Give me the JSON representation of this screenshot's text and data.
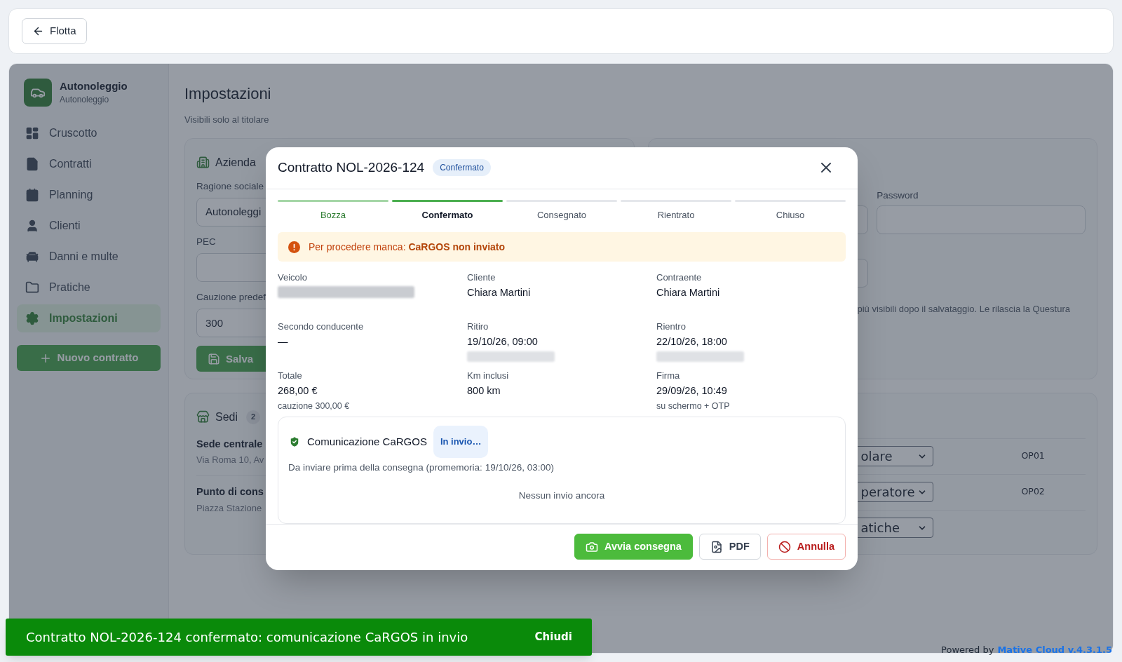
{
  "top_bar": {
    "back_button": "Flotta"
  },
  "sidebar": {
    "app_name": "Autonoleggio",
    "app_subtitle": "Autonoleggio",
    "items": [
      {
        "label": "Cruscotto",
        "selected": false
      },
      {
        "label": "Contratti",
        "selected": false
      },
      {
        "label": "Planning",
        "selected": false
      },
      {
        "label": "Clienti",
        "selected": false
      },
      {
        "label": "Danni e multe",
        "selected": false
      },
      {
        "label": "Pratiche",
        "selected": false
      },
      {
        "label": "Impostazioni",
        "selected": true
      }
    ],
    "new_button": "Nuovo contratto"
  },
  "page": {
    "title": "Impostazioni",
    "subtitle": "Visibili solo al titolare",
    "company_card": {
      "title": "Azienda",
      "fields": [
        {
          "label": "Ragione sociale",
          "value": "Autonoleggi"
        },
        {
          "label": "PEC"
        },
        {
          "label": "Cauzione predef",
          "value": "300"
        }
      ],
      "save_button": "Salva"
    },
    "credentials_card": {
      "password_label": "Password",
      "note": "più visibili dopo il salvataggio. Le rilascia la Questura"
    },
    "locations_card": {
      "title": "Sedi",
      "count": "2",
      "items": [
        {
          "name": "Sede centrale",
          "address": "Via Roma 10, Av"
        },
        {
          "name": "Punto di cons",
          "address": "Piazza Stazione"
        }
      ]
    },
    "users_card": {
      "rows": [
        {
          "role": "olare",
          "code": "OP01"
        },
        {
          "role": "peratore",
          "code": "OP02"
        },
        {
          "role": "atiche"
        }
      ]
    }
  },
  "modal": {
    "title": "Contratto NOL-2026-124",
    "status_badge": "Confermato",
    "steps": [
      {
        "label": "Bozza",
        "done": true,
        "selected": false
      },
      {
        "label": "Confermato",
        "done": false,
        "selected": true
      },
      {
        "label": "Consegnato",
        "done": false,
        "selected": false
      },
      {
        "label": "Rientrato",
        "done": false,
        "selected": false
      },
      {
        "label": "Chiuso",
        "done": false,
        "selected": false
      }
    ],
    "warning": "Per procedere manca: **CaRGOS non inviato**",
    "details": [
      {
        "label": "Veicolo",
        "kind": "blurred",
        "blurred_line": false
      },
      {
        "label": "Cliente",
        "kind": "text",
        "value": "Chiara Martini",
        "blurred_line": false
      },
      {
        "label": "Contraente",
        "kind": "text",
        "value": "Chiara Martini",
        "blurred_line": false
      },
      {
        "label": "Secondo conducente",
        "kind": "text",
        "value": "—",
        "blurred_line": false
      },
      {
        "label": "Ritiro",
        "kind": "text",
        "value": "19/10/26, 09:00",
        "blurred_line": true
      },
      {
        "label": "Rientro",
        "kind": "text",
        "value": "22/10/26, 18:00",
        "blurred_line": true
      },
      {
        "label": "Totale",
        "kind": "text",
        "value": "268,00 €",
        "note": "cauzione 300,00 €",
        "blurred_line": false
      },
      {
        "label": "Km inclusi",
        "kind": "text",
        "value": "800 km",
        "blurred_line": false
      },
      {
        "label": "Firma",
        "kind": "text",
        "value": "29/09/26, 10:49",
        "note": "su schermo + OTP",
        "blurred_line": false
      }
    ],
    "cargos": {
      "title": "Comunicazione CaRGOS",
      "badge": "In invio…",
      "text": "Da inviare prima della consegna (promemoria: 19/10/26, 03:00)",
      "empty": "Nessun invio ancora"
    },
    "buttons": [
      {
        "label": "Avvia consegna",
        "kind": "primary"
      },
      {
        "label": "PDF",
        "kind": "outline"
      },
      {
        "label": "Annulla",
        "kind": "danger"
      }
    ]
  },
  "toast": {
    "message": "Contratto NOL-2026-124 confermato: comunicazione CaRGOS in invio",
    "action": "Chiudi"
  },
  "footer": {
    "prefix": "Powered by",
    "link": "Mative Cloud v.4.3.1.5"
  }
}
